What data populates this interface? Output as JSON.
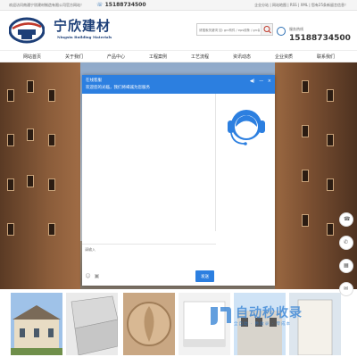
{
  "topbar": {
    "welcome": "欢迎访问南通宁欣建材制造有限公司官方网站！",
    "hotline": "15188734500",
    "links": "企业分站 | 网站地图 | RSS | XML | 您有25条新留言信息！"
  },
  "header": {
    "brand_cn": "宁欣建材",
    "brand_en": "Ningxin Building Materials",
    "search_placeholder": "请搜索关键词 如: grc构件 / eps线条 / grc装饰构件",
    "hotline_label": "服务热线",
    "hotline_number": "15188734500"
  },
  "nav": {
    "items": [
      {
        "label": "网站首页"
      },
      {
        "label": "关于我们"
      },
      {
        "label": "产品中心"
      },
      {
        "label": "工程案例"
      },
      {
        "label": "工艺流程"
      },
      {
        "label": "资讯动态"
      },
      {
        "label": "企业资质"
      },
      {
        "label": "联系我们"
      }
    ]
  },
  "chat": {
    "title": "在线客服",
    "welcome": "欢迎您的光临，我们将竭诚为您服务",
    "input_placeholder": "请输入",
    "send_label": "发送",
    "controls": {
      "sound": "◀)",
      "minimize": "—",
      "close": "×"
    },
    "tools": {
      "emoji": "☺",
      "image": "▣"
    }
  },
  "sidebar_float": {
    "icons": [
      {
        "name": "headset-icon",
        "glyph": "☎"
      },
      {
        "name": "phone-icon",
        "glyph": "✆"
      },
      {
        "name": "qrcode-icon",
        "glyph": "▦"
      },
      {
        "name": "message-icon",
        "glyph": "✉"
      }
    ]
  },
  "watermark": {
    "title": "自动秒收录",
    "sub": "全自动 · 秒收录 · 零成本"
  },
  "colors": {
    "chat_primary": "#2c7fe0",
    "brand_blue": "#1d3f78"
  }
}
